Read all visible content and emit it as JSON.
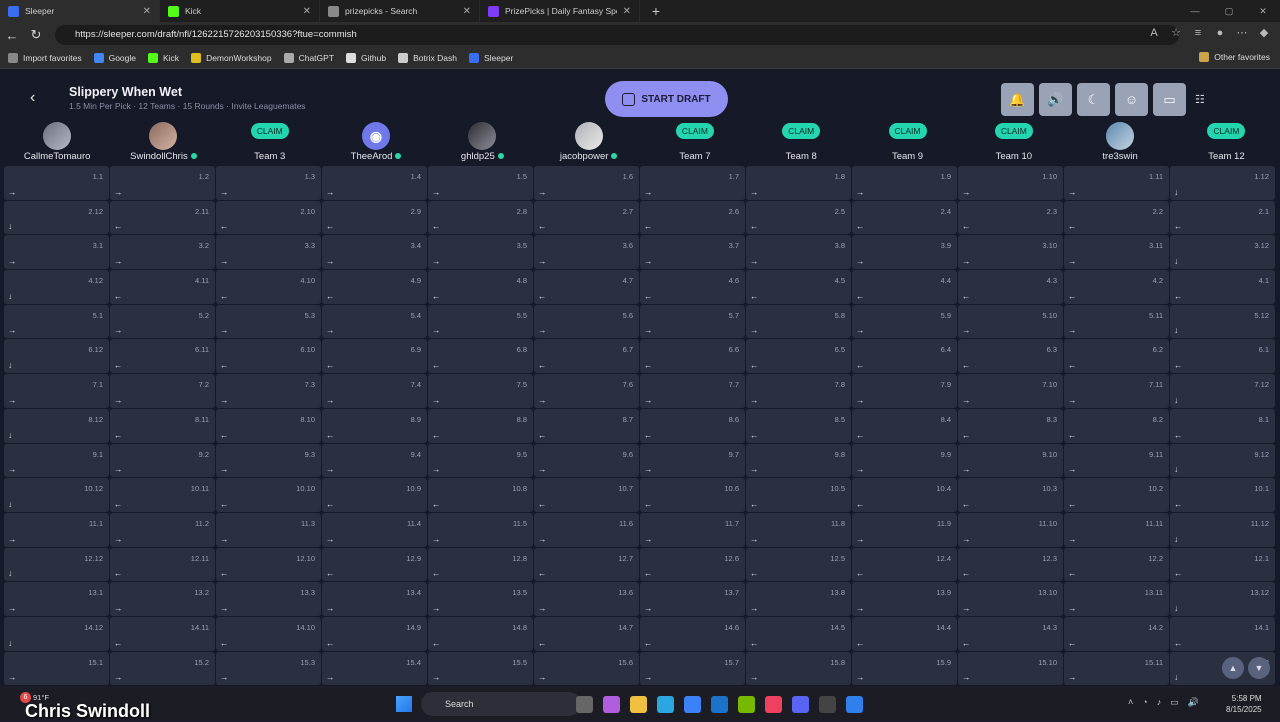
{
  "browser": {
    "tabs": [
      {
        "label": "Sleeper",
        "favicon": "sleeper-icon",
        "color": "#3a6df0"
      },
      {
        "label": "Kick",
        "favicon": "kick-icon",
        "color": "#53fc18"
      },
      {
        "label": "prizepicks - Search",
        "favicon": "search-icon",
        "color": "#888888"
      },
      {
        "label": "PrizePicks | Daily Fantasy Sports M",
        "favicon": "prizepicks-icon",
        "color": "#7c3cf5"
      }
    ],
    "url": "https://sleeper.com/draft/nfl/1262215726203150336?ftue=commish",
    "bookmarks": [
      "Import favorites",
      "Google",
      "Kick",
      "DemonWorkshop",
      "ChatGPT",
      "Github",
      "Botrix Dash",
      "Sleeper"
    ],
    "other_favorites": "Other favorites"
  },
  "draft": {
    "title": "Slippery When Wet",
    "subtitle": "1.5 Min Per Pick · 12 Teams · 15 Rounds · Invite Leaguemates",
    "start_button": "START DRAFT",
    "claim_label": "CLAIM",
    "teams": [
      {
        "name": "CallmeTomauro",
        "type": "avatar",
        "online": false
      },
      {
        "name": "SwindollChris",
        "type": "avatar",
        "online": true
      },
      {
        "name": "Team 3",
        "type": "claim",
        "online": false
      },
      {
        "name": "TheeArod",
        "type": "avatar",
        "online": true
      },
      {
        "name": "ghldp25",
        "type": "avatar",
        "online": true
      },
      {
        "name": "jacobpower",
        "type": "avatar",
        "online": true
      },
      {
        "name": "Team 7",
        "type": "claim",
        "online": false
      },
      {
        "name": "Team 8",
        "type": "claim",
        "online": false
      },
      {
        "name": "Team 9",
        "type": "claim",
        "online": false
      },
      {
        "name": "Team 10",
        "type": "claim",
        "online": false
      },
      {
        "name": "tre3swin",
        "type": "avatar",
        "online": false
      },
      {
        "name": "Team 12",
        "type": "claim",
        "online": false
      }
    ],
    "rounds": 15,
    "teams_count": 12
  },
  "taskbar": {
    "weather": "91°F",
    "overlay_name": "Chris Swindoll",
    "search_placeholder": "Search",
    "time": "5:58 PM",
    "date": "8/15/2025"
  },
  "colors": {
    "accent": "#8e8ff0",
    "claim": "#23d6b0",
    "cell": "#2b3040",
    "background": "#161a28"
  }
}
